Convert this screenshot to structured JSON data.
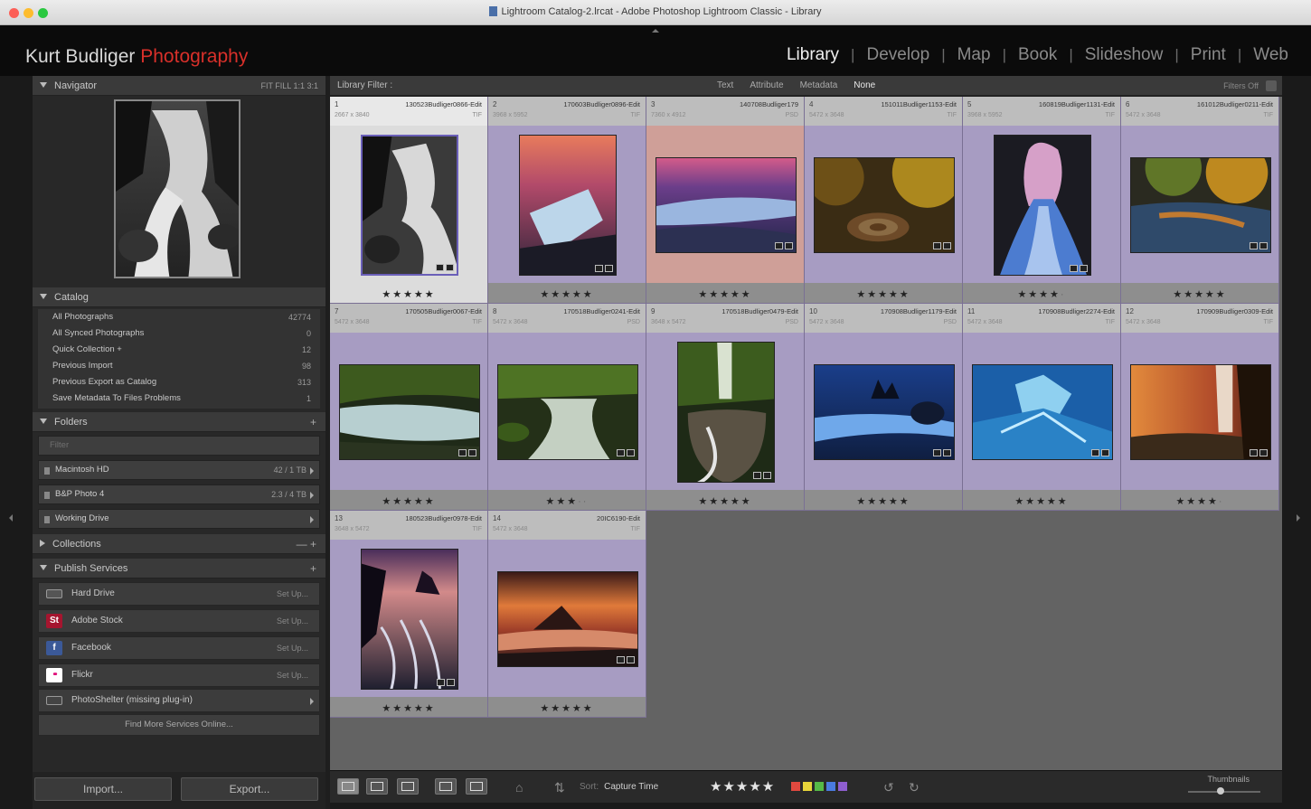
{
  "window": {
    "title": "Lightroom Catalog-2.lrcat - Adobe Photoshop Lightroom Classic - Library"
  },
  "identity": {
    "name": "Kurt Budliger",
    "accent": "Photography",
    "accent_color": "#d8302a"
  },
  "modules": [
    "Library",
    "Develop",
    "Map",
    "Book",
    "Slideshow",
    "Print",
    "Web"
  ],
  "active_module": "Library",
  "navigator": {
    "title": "Navigator",
    "zoom_options": "FIT  FILL  1:1  3:1"
  },
  "catalog": {
    "title": "Catalog",
    "items": [
      {
        "label": "All Photographs",
        "count": "42774"
      },
      {
        "label": "All Synced Photographs",
        "count": "0"
      },
      {
        "label": "Quick Collection +",
        "count": "12"
      },
      {
        "label": "Previous Import",
        "count": "98"
      },
      {
        "label": "Previous Export as Catalog",
        "count": "313"
      },
      {
        "label": "Save Metadata To Files Problems",
        "count": "1"
      }
    ]
  },
  "folders": {
    "title": "Folders",
    "filter_placeholder": "Filter",
    "volumes": [
      {
        "label": "Macintosh HD",
        "count": "42 / 1 TB"
      },
      {
        "label": "B&P Photo 4",
        "count": "2.3 / 4 TB"
      },
      {
        "label": "Working Drive",
        "count": ""
      }
    ]
  },
  "collections": {
    "title": "Collections",
    "controls": "— +"
  },
  "publish": {
    "title": "Publish Services",
    "services": [
      {
        "label": "Hard Drive",
        "setup": "Set Up...",
        "icon": "hard-drive-icon",
        "color": "#555555",
        "glyph": ""
      },
      {
        "label": "Adobe Stock",
        "setup": "Set Up...",
        "icon": "adobe-stock-icon",
        "color": "#a5152f",
        "glyph": "St"
      },
      {
        "label": "Facebook",
        "setup": "Set Up...",
        "icon": "facebook-icon",
        "color": "#3b5998",
        "glyph": "f"
      },
      {
        "label": "Flickr",
        "setup": "Set Up...",
        "icon": "flickr-icon",
        "color": "#ffffff",
        "glyph": "••"
      },
      {
        "label": "PhotoShelter (missing plug-in)",
        "setup": "",
        "icon": "folder-icon",
        "color": "#444444",
        "glyph": ""
      }
    ],
    "find_more": "Find More Services Online..."
  },
  "buttons": {
    "import": "Import...",
    "export": "Export..."
  },
  "filter_bar": {
    "title": "Library Filter :",
    "options": [
      "Text",
      "Attribute",
      "Metadata",
      "None"
    ],
    "active": "None",
    "filters_off": "Filters Off"
  },
  "grid": {
    "cells": [
      {
        "index": "1",
        "file": "130523Budliger0866-Edit",
        "sub": "2667 x 3840",
        "ext": "TIF",
        "stars": 5,
        "state": "selected",
        "shape": "portrait",
        "palette": "bw"
      },
      {
        "index": "2",
        "file": "170603Budliger0896-Edit",
        "sub": "3968 x 5952",
        "ext": "TIF",
        "stars": 5,
        "state": "normal",
        "shape": "portrait",
        "palette": "ice"
      },
      {
        "index": "3",
        "file": "140708Budliger179",
        "sub": "7360 x 4912",
        "ext": "PSD",
        "stars": 5,
        "state": "red",
        "shape": "landscape",
        "palette": "sunset-river"
      },
      {
        "index": "4",
        "file": "151011Budliger1153-Edit",
        "sub": "5472 x 3648",
        "ext": "TIF",
        "stars": 5,
        "state": "normal",
        "shape": "landscape",
        "palette": "autumn"
      },
      {
        "index": "5",
        "file": "160819Budliger1131-Edit",
        "sub": "3968 x 5952",
        "ext": "TIF",
        "stars": 4,
        "state": "normal",
        "shape": "portrait",
        "palette": "cave"
      },
      {
        "index": "6",
        "file": "161012Budliger0211-Edit",
        "sub": "5472 x 3648",
        "ext": "TIF",
        "stars": 5,
        "state": "normal",
        "shape": "landscape",
        "palette": "autumn-river"
      },
      {
        "index": "7",
        "file": "170505Budliger0067-Edit",
        "sub": "5472 x 3648",
        "ext": "TIF",
        "stars": 5,
        "state": "normal",
        "shape": "landscape",
        "palette": "green-stream"
      },
      {
        "index": "8",
        "file": "170518Budliger0241-Edit",
        "sub": "5472 x 3648",
        "ext": "PSD",
        "stars": 3,
        "state": "normal",
        "shape": "landscape",
        "palette": "mossy-falls"
      },
      {
        "index": "9",
        "file": "170518Budliger0479-Edit",
        "sub": "3648 x 5472",
        "ext": "PSD",
        "stars": 5,
        "state": "normal",
        "shape": "portrait",
        "palette": "forest-falls"
      },
      {
        "index": "10",
        "file": "170908Budliger1179-Edit",
        "sub": "5472 x 3648",
        "ext": "PSD",
        "stars": 5,
        "state": "normal",
        "shape": "landscape",
        "palette": "blue-sea"
      },
      {
        "index": "11",
        "file": "170908Budliger2274-Edit",
        "sub": "5472 x 3648",
        "ext": "TIF",
        "stars": 5,
        "state": "normal",
        "shape": "landscape",
        "palette": "blue-ice"
      },
      {
        "index": "12",
        "file": "170909Budliger0309-Edit",
        "sub": "5472 x 3648",
        "ext": "TIF",
        "stars": 4,
        "state": "normal",
        "shape": "landscape",
        "palette": "waterfall-sunset"
      },
      {
        "index": "13",
        "file": "180523Budliger0978-Edit",
        "sub": "3648 x 5472",
        "ext": "TIF",
        "stars": 5,
        "state": "normal",
        "shape": "portrait",
        "palette": "coast-dusk"
      },
      {
        "index": "14",
        "file": "20IC6190-Edit",
        "sub": "5472 x 3648",
        "ext": "TIF",
        "stars": 5,
        "state": "normal",
        "shape": "landscape",
        "palette": "mountain-sunset"
      }
    ]
  },
  "toolbar": {
    "sort_label": "Sort:",
    "sort_value": "Capture Time",
    "rating": "★★★★★",
    "labels": [
      "#e0493f",
      "#e8d53a",
      "#56b947",
      "#4a7be0",
      "#8e5ecf"
    ],
    "thumbnails_label": "Thumbnails",
    "thumbnail_size": 0.45
  }
}
